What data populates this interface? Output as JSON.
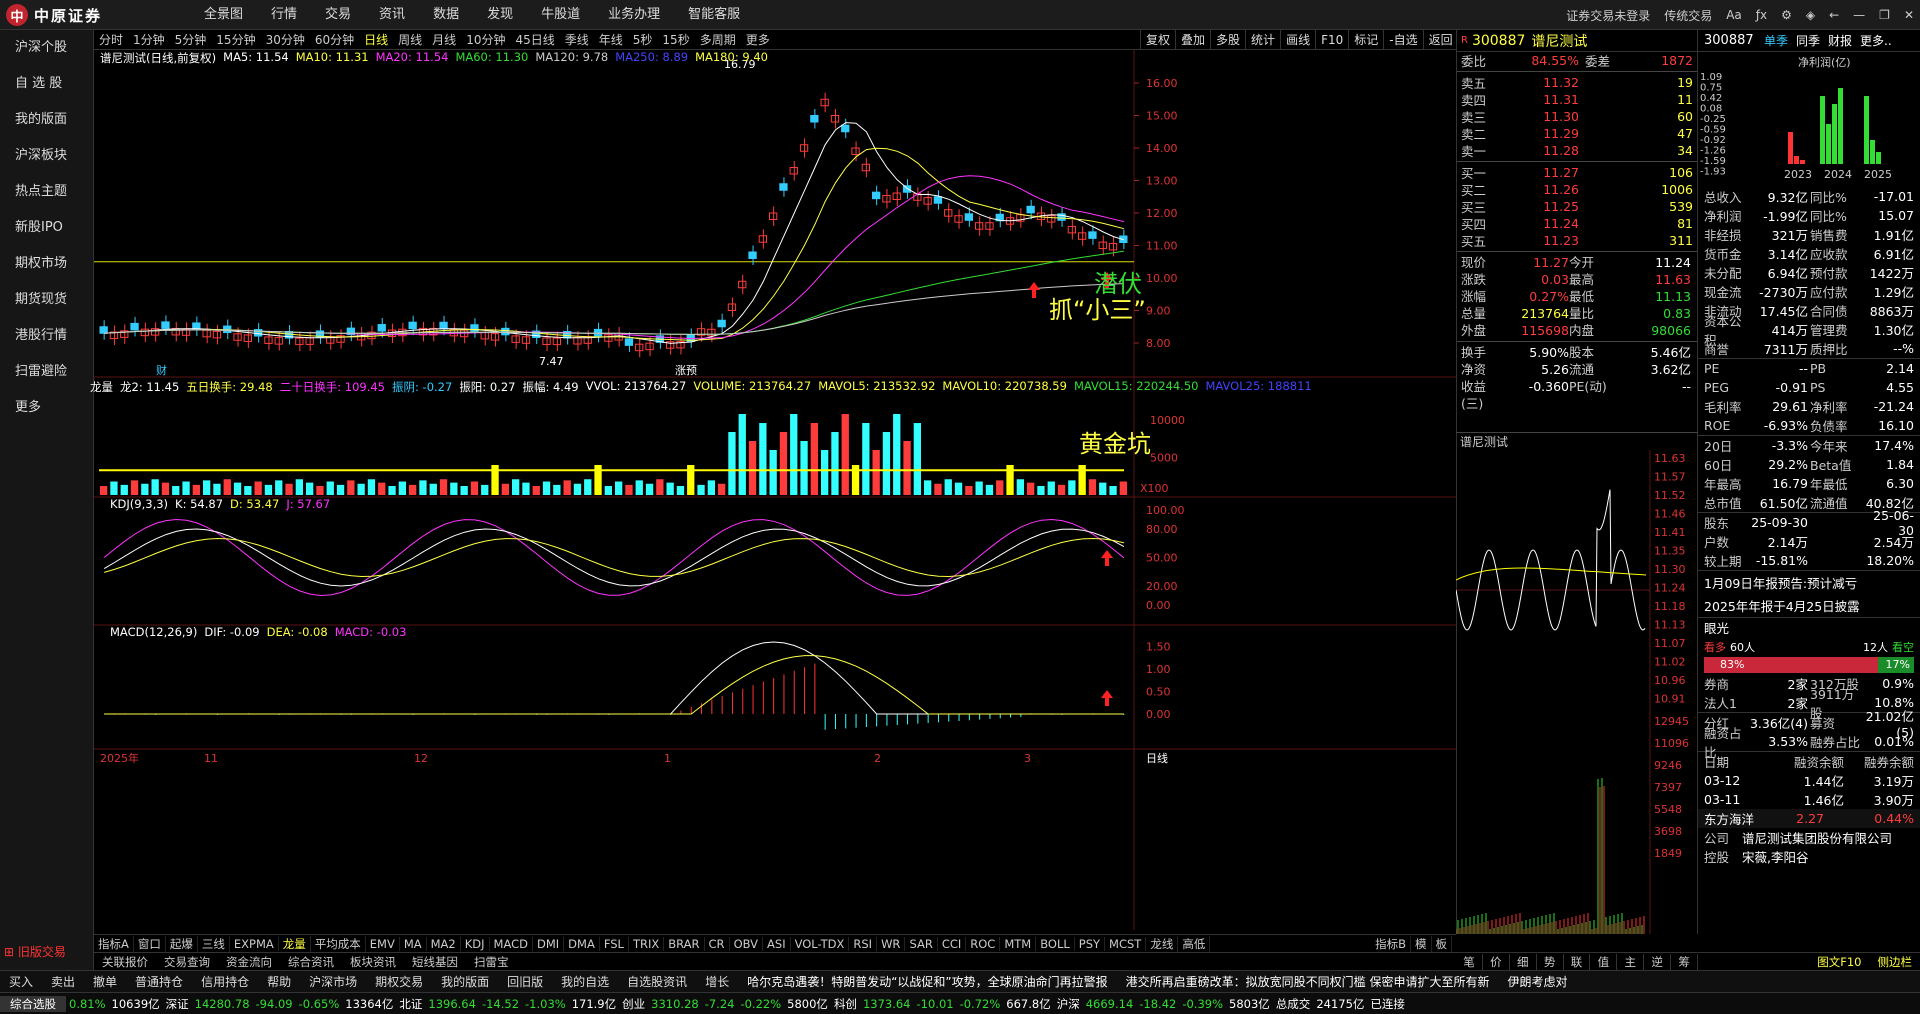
{
  "app": {
    "logo_text": "中原证券",
    "logo_mark": "中"
  },
  "main_menu": [
    "全景图",
    "行情",
    "交易",
    "资讯",
    "数据",
    "发现",
    "牛股道",
    "业务办理",
    "智能客服"
  ],
  "top_right": [
    "证券交易未登录",
    "传统交易"
  ],
  "sidebar": [
    "沪深个股",
    "自 选 股",
    "我的版面",
    "沪深板块",
    "热点主题",
    "新股IPO",
    "期权市场",
    "期货现货",
    "港股行情",
    "扫雷避险",
    "更多"
  ],
  "sidebar_old": "旧版交易",
  "periods": [
    "分时",
    "1分钟",
    "5分钟",
    "15分钟",
    "30分钟",
    "60分钟",
    "日线",
    "周线",
    "月线",
    "10分钟",
    "45日线",
    "季线",
    "年线",
    "5秒",
    "15秒",
    "多周期",
    "更多"
  ],
  "active_period": "日线",
  "chart_tools": [
    "复权",
    "叠加",
    "多股",
    "统计",
    "画线",
    "F10",
    "标记",
    "-自选",
    "返回"
  ],
  "legend_main": {
    "title": "谱尼测试(日线,前复权)",
    "ma5": "MA5: 11.54",
    "ma10": "MA10: 11.31",
    "ma20": "MA20: 11.54",
    "ma60": "MA60: 11.30",
    "ma120": "MA120: 9.78",
    "ma250": "MA250: 8.89",
    "ma180": "MA180: 9.40"
  },
  "legend_vol": {
    "name": "龙量",
    "l2": "龙2: 11.45",
    "t5": "五日换手: 29.48",
    "t20": "二十日换手: 109.45",
    "zy": "振阴: -0.27",
    "zyang": "振阳: 0.27",
    "zf": "振幅: 4.49",
    "vvol": "VVOL: 213764.27",
    "volume": "VOLUME: 213764.27",
    "mv5": "MAVOL5: 213532.92",
    "mv10": "MAVOL10: 220738.59",
    "mv15": "MAVOL15: 220244.50",
    "mv25": "MAVOL25: 188811"
  },
  "legend_kdj": {
    "name": "KDJ(9,3,3)",
    "k": "K: 54.87",
    "d": "D: 53.47",
    "j": "J: 57.67"
  },
  "legend_macd": {
    "name": "MACD(12,26,9)",
    "dif": "DIF: -0.09",
    "dea": "DEA: -0.08",
    "macd": "MACD: -0.03"
  },
  "annotations": {
    "qianfu": "潜伏",
    "zhua": "抓“小三”",
    "huangjin": "黄金坑",
    "high": "16.79",
    "low": "7.47",
    "cai": "财",
    "zhangting": "涨预"
  },
  "price_axis": [
    "16.00",
    "15.00",
    "14.00",
    "13.00",
    "12.00",
    "11.00",
    "10.00",
    "9.00",
    "8.00"
  ],
  "vol_axis": [
    "10000",
    "5000",
    "X100"
  ],
  "kdj_axis": [
    "100.00",
    "80.00",
    "50.00",
    "20.00",
    "0.00"
  ],
  "macd_axis": [
    "1.50",
    "1.00",
    "0.50",
    "0.00"
  ],
  "date_axis": [
    "2025年",
    "11",
    "12",
    "1",
    "2",
    "3"
  ],
  "date_axis_right": "日线",
  "indicator_tabs": [
    "指标A",
    "窗口",
    "起爆",
    "三线",
    "EXPMA",
    "龙量",
    "平均成本",
    "EMV",
    "MA",
    "MA2",
    "KDJ",
    "MACD",
    "DMI",
    "DMA",
    "FSL",
    "TRIX",
    "BRAR",
    "CR",
    "OBV",
    "ASI",
    "VOL-TDX",
    "RSI",
    "WR",
    "SAR",
    "CCI",
    "ROC",
    "MTM",
    "BOLL",
    "PSY",
    "MCST",
    "龙线",
    "高低"
  ],
  "indicator_tabs_right": [
    "指标B",
    "模",
    "板"
  ],
  "bottom_links": [
    "关联报价",
    "交易查询",
    "资金流向",
    "综合资讯",
    "板块资讯",
    "短线基因",
    "扫雷宝"
  ],
  "bottom_right": [
    "图文F10",
    "侧边栏"
  ],
  "action_bar": [
    "买入",
    "卖出",
    "撤单",
    "普通持仓",
    "信用持仓",
    "帮助",
    "沪深市场",
    "期权交易",
    "我的版面",
    "回旧版",
    "我的自选",
    "自选股资讯",
    "增长"
  ],
  "news": "哈尔克岛遇袭！特朗普发动“以战促和”攻势，全球原油命门再拉警报",
  "news2": "港交所再启重磅改革：拟放宽同股不同权门槛 保密申请扩大至所有新",
  "news3": "伊朗考虑对",
  "ticker": [
    {
      "label": "综合选股",
      "v": ""
    },
    {
      "label": "",
      "v": "0.81%",
      "c": "green"
    },
    {
      "label": "",
      "v": "10639亿",
      "c": "white"
    },
    {
      "label": "深证",
      "v": "14280.78",
      "c": "green"
    },
    {
      "label": "",
      "v": "-94.09",
      "c": "green"
    },
    {
      "label": "",
      "v": "-0.65%",
      "c": "green"
    },
    {
      "label": "",
      "v": "13364亿",
      "c": "white"
    },
    {
      "label": "北证",
      "v": "1396.64",
      "c": "green"
    },
    {
      "label": "",
      "v": "-14.52",
      "c": "green"
    },
    {
      "label": "",
      "v": "-1.03%",
      "c": "green"
    },
    {
      "label": "",
      "v": "171.9亿",
      "c": "white"
    },
    {
      "label": "创业",
      "v": "3310.28",
      "c": "green"
    },
    {
      "label": "",
      "v": "-7.24",
      "c": "green"
    },
    {
      "label": "",
      "v": "-0.22%",
      "c": "green"
    },
    {
      "label": "",
      "v": "5800亿",
      "c": "white"
    },
    {
      "label": "科创",
      "v": "1373.64",
      "c": "green"
    },
    {
      "label": "",
      "v": "-10.01",
      "c": "green"
    },
    {
      "label": "",
      "v": "-0.72%",
      "c": "green"
    },
    {
      "label": "",
      "v": "667.8亿",
      "c": "white"
    },
    {
      "label": "沪深",
      "v": "4669.14",
      "c": "green"
    },
    {
      "label": "",
      "v": "-18.42",
      "c": "green"
    },
    {
      "label": "",
      "v": "-0.39%",
      "c": "green"
    },
    {
      "label": "",
      "v": "5803亿",
      "c": "white"
    },
    {
      "label": "总成交",
      "v": "24175亿",
      "c": "white"
    },
    {
      "label": "",
      "v": "已连接",
      "c": "white"
    }
  ],
  "quote": {
    "code": "300887",
    "name": "谱尼测试",
    "wb": "84.55%",
    "wc": "1872",
    "asks": [
      [
        "卖五",
        "11.32",
        "19"
      ],
      [
        "卖四",
        "11.31",
        "11"
      ],
      [
        "卖三",
        "11.30",
        "60"
      ],
      [
        "卖二",
        "11.29",
        "47"
      ],
      [
        "卖一",
        "11.28",
        "34"
      ]
    ],
    "bids": [
      [
        "买一",
        "11.27",
        "106"
      ],
      [
        "买二",
        "11.26",
        "1006"
      ],
      [
        "买三",
        "11.25",
        "539"
      ],
      [
        "买四",
        "11.24",
        "81"
      ],
      [
        "买五",
        "11.23",
        "311"
      ]
    ],
    "stats": [
      [
        "现价",
        "11.27",
        "今开",
        "11.24"
      ],
      [
        "涨跌",
        "0.03",
        "最高",
        "11.63"
      ],
      [
        "涨幅",
        "0.27%",
        "最低",
        "11.13"
      ],
      [
        "总量",
        "213764",
        "量比",
        "0.83"
      ],
      [
        "外盘",
        "115698",
        "内盘",
        "98066"
      ]
    ],
    "stats2": [
      [
        "换手",
        "5.90%",
        "股本",
        "5.46亿"
      ],
      [
        "净资",
        "5.26",
        "流通",
        "3.62亿"
      ],
      [
        "收益(三)",
        "-0.360",
        "PE(动)",
        "--"
      ]
    ],
    "mini_title": "谱尼测试",
    "mini_axis": [
      "11.63",
      "11.57",
      "11.52",
      "11.46",
      "11.41",
      "11.35",
      "11.30",
      "11.24",
      "11.18",
      "11.13",
      "11.07",
      "11.02",
      "10.96",
      "10.91",
      "12945",
      "11096",
      "9246",
      "7397",
      "5548",
      "3698",
      "1849"
    ],
    "bottom_tabs": [
      "笔",
      "价",
      "细",
      "势",
      "联",
      "值",
      "主",
      "逆",
      "筹"
    ]
  },
  "fin": {
    "code": "300887",
    "tabs": [
      "单季",
      "同季",
      "财报",
      "更多.."
    ],
    "chart_label": "净利润(亿)",
    "chart_axis": [
      "1.09",
      "0.75",
      "0.42",
      "0.08",
      "-0.25",
      "-0.59",
      "-0.92",
      "-1.26",
      "-1.59",
      "-1.93"
    ],
    "chart_years": [
      "2023",
      "2024",
      "2025"
    ],
    "rows": [
      [
        "总收入",
        "9.32亿",
        "同比%",
        "-17.01"
      ],
      [
        "净利润",
        "-1.99亿",
        "同比%",
        "15.07"
      ],
      [
        "非经损",
        "321万",
        "销售费",
        "1.91亿"
      ],
      [
        "货币金",
        "3.14亿",
        "应收款",
        "6.91亿"
      ],
      [
        "未分配",
        "6.94亿",
        "预付款",
        "1422万"
      ],
      [
        "现金流",
        "-2730万",
        "应付款",
        "1.29亿"
      ],
      [
        "非流动",
        "17.45亿",
        "合同债",
        "8863万"
      ],
      [
        "资本公积",
        "414万",
        "管理费",
        "1.30亿"
      ],
      [
        "商誉",
        "7311万",
        "质押比",
        "--%"
      ]
    ],
    "rows2": [
      [
        "PE",
        "--",
        "PB",
        "2.14"
      ],
      [
        "PEG",
        "-0.91",
        "PS",
        "4.55"
      ],
      [
        "毛利率",
        "29.61",
        "净利率",
        "-21.24"
      ],
      [
        "ROE",
        "-6.93%",
        "负债率",
        "16.10"
      ]
    ],
    "rows3": [
      [
        "20日",
        "-3.3%",
        "今年来",
        "17.4%"
      ],
      [
        "60日",
        "29.2%",
        "Beta值",
        "1.84"
      ],
      [
        "年最高",
        "16.79",
        "年最低",
        "6.30"
      ],
      [
        "总市值",
        "61.50亿",
        "流通值",
        "40.82亿"
      ]
    ],
    "rows4": [
      [
        "股东",
        "25-09-30",
        "",
        "25-06-30"
      ],
      [
        "户数",
        "2.14万",
        "",
        "2.54万"
      ],
      [
        "较上期",
        "-15.81%",
        "",
        "18.20%"
      ]
    ],
    "notice1": "1月09日年报预告:预计减亏",
    "notice2": "2025年年报于4月25日披露",
    "sentiment": {
      "label": "眼光",
      "bull": "看多",
      "bull_n": "60人",
      "bear_n": "12人",
      "bear": "看空",
      "bull_pct": "83%",
      "bear_pct": "17%"
    },
    "brokers": [
      [
        "券商",
        "2家",
        "312万股",
        "0.9%"
      ],
      [
        "法人1",
        "2家",
        "3911万股",
        "10.8%"
      ]
    ],
    "bonus": [
      [
        "分红",
        "3.36亿(4)",
        "募资",
        "21.02亿(5)"
      ],
      [
        "融资占比",
        "3.53%",
        "融券占比",
        "0.01%"
      ]
    ],
    "margin_head": [
      "日期",
      "融资余额",
      "融券余额"
    ],
    "margin": [
      [
        "03-12",
        "1.44亿",
        "3.19万"
      ],
      [
        "03-11",
        "1.46亿",
        "3.90万"
      ]
    ],
    "related": {
      "name": "东方海洋",
      "price": "2.27",
      "pct": "0.44%"
    },
    "company": [
      "公司",
      "谱尼测试集团股份有限公司"
    ],
    "holder": [
      "控股",
      "宋薇,李阳谷"
    ]
  }
}
